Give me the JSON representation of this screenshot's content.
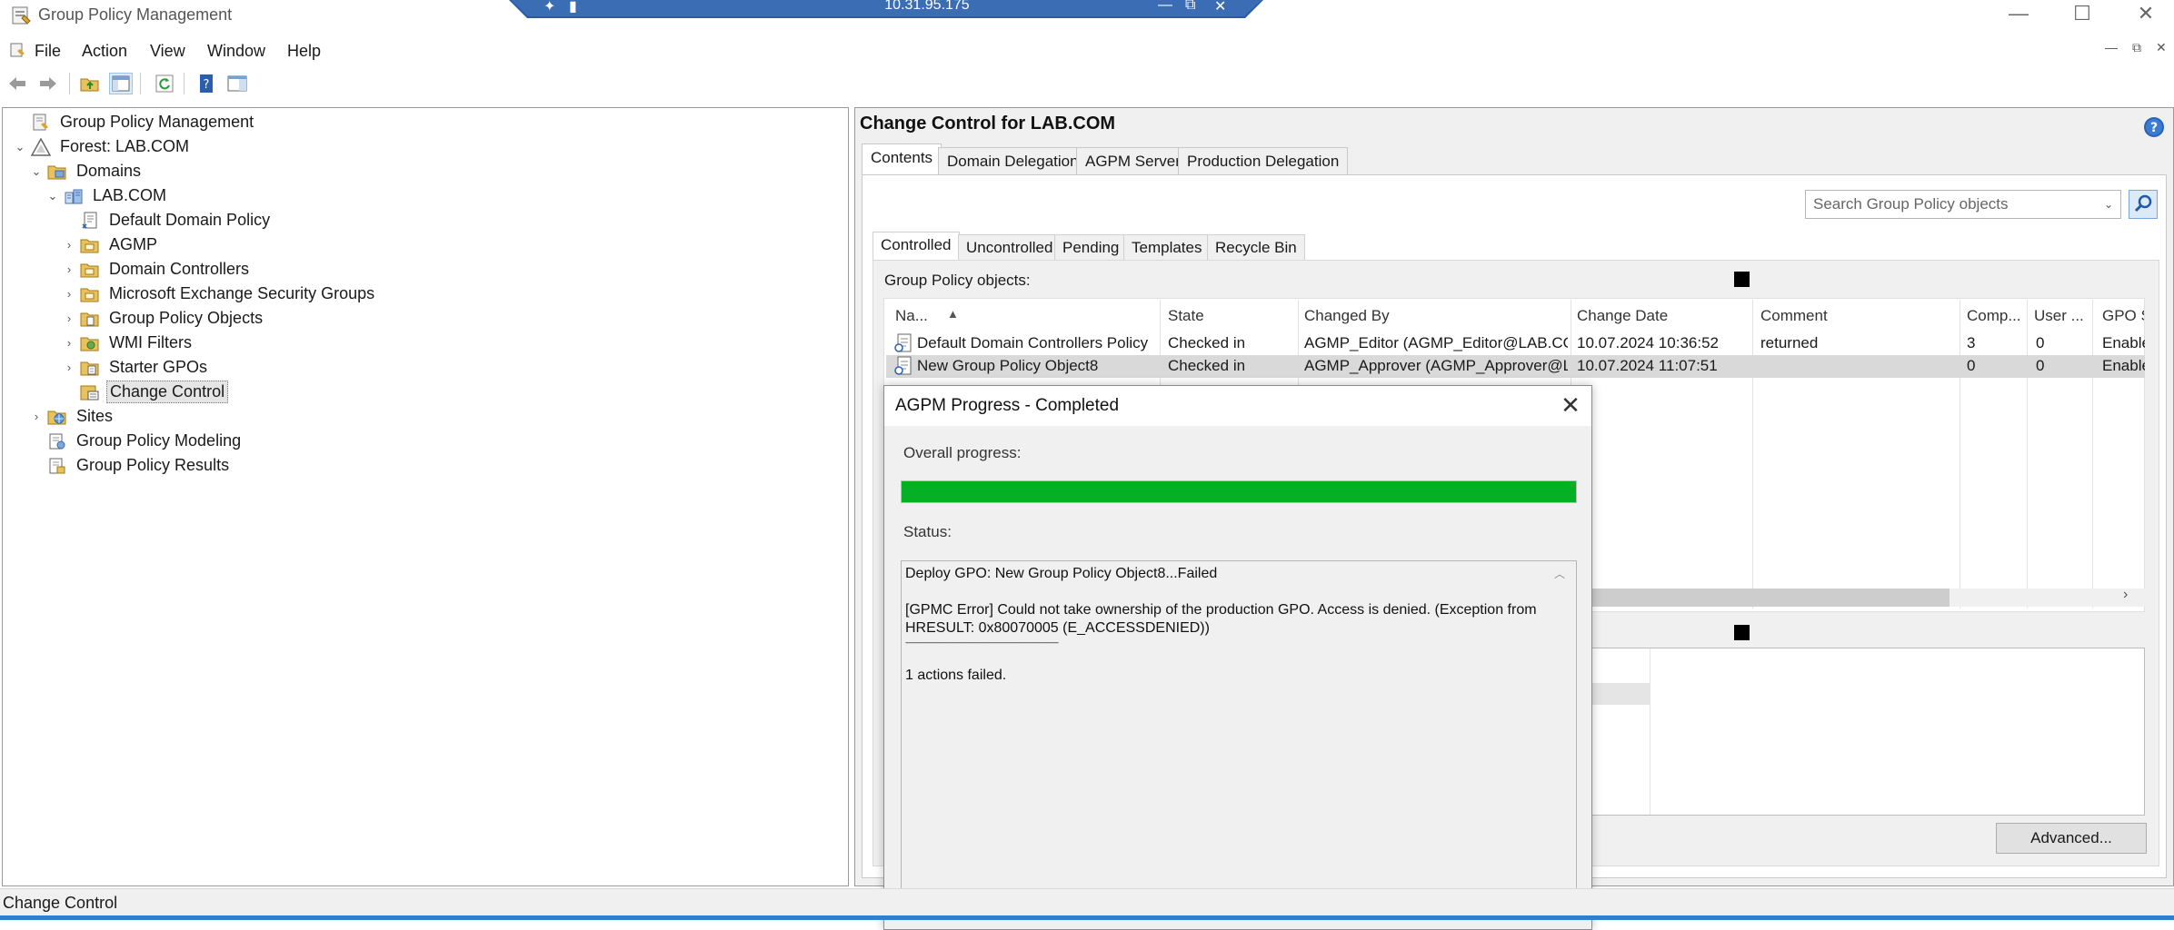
{
  "window": {
    "title": "Group Policy Management",
    "remote_host": "10.31.95.175",
    "controls": [
      "—",
      "☐",
      "✕"
    ]
  },
  "menu": [
    "File",
    "Action",
    "View",
    "Window",
    "Help"
  ],
  "tree": [
    {
      "label": "Group Policy Management",
      "icon": "gpm-console-icon",
      "expander": "",
      "depth": 0
    },
    {
      "label": "Forest: LAB.COM",
      "icon": "forest-icon",
      "expander": "⌄",
      "depth": 0
    },
    {
      "label": "Domains",
      "icon": "domains-folder-icon",
      "expander": "⌄",
      "depth": 1
    },
    {
      "label": "LAB.COM",
      "icon": "domain-icon",
      "expander": "⌄",
      "depth": 2
    },
    {
      "label": "Default Domain Policy",
      "icon": "gpo-link-icon",
      "expander": "",
      "depth": 3
    },
    {
      "label": "AGMP",
      "icon": "ou-folder-icon",
      "expander": "›",
      "depth": 3
    },
    {
      "label": "Domain Controllers",
      "icon": "ou-folder-icon",
      "expander": "›",
      "depth": 3
    },
    {
      "label": "Microsoft Exchange Security Groups",
      "icon": "ou-folder-icon",
      "expander": "›",
      "depth": 3
    },
    {
      "label": "Group Policy Objects",
      "icon": "gpo-folder-icon",
      "expander": "›",
      "depth": 3
    },
    {
      "label": "WMI Filters",
      "icon": "wmi-folder-icon",
      "expander": "›",
      "depth": 3
    },
    {
      "label": "Starter GPOs",
      "icon": "starter-folder-icon",
      "expander": "›",
      "depth": 3
    },
    {
      "label": "Change Control",
      "icon": "change-control-icon",
      "expander": "",
      "depth": 3,
      "selected": true
    },
    {
      "label": "Sites",
      "icon": "sites-icon",
      "expander": "›",
      "depth": 1
    },
    {
      "label": "Group Policy Modeling",
      "icon": "modeling-icon",
      "expander": "",
      "depth": 1
    },
    {
      "label": "Group Policy Results",
      "icon": "results-icon",
      "expander": "",
      "depth": 1
    }
  ],
  "change_control": {
    "title": "Change Control for LAB.COM",
    "tabs": [
      "Contents",
      "Domain Delegation",
      "AGPM Server",
      "Production Delegation"
    ],
    "active_tab": "Contents",
    "search_placeholder": "Search Group Policy objects",
    "subtabs": [
      "Controlled",
      "Uncontrolled",
      "Pending",
      "Templates",
      "Recycle Bin"
    ],
    "active_subtab": "Controlled",
    "gpo_label": "Group Policy objects:",
    "columns": [
      "Na...",
      "State",
      "Changed By",
      "Change Date",
      "Comment",
      "Comp...",
      "User ...",
      "GPO S"
    ],
    "rows": [
      [
        "Default Domain Controllers Policy",
        "Checked in",
        "AGMP_Editor (AGMP_Editor@LAB.COM)",
        "10.07.2024 10:36:52",
        "returned",
        "3",
        "0",
        "Enable"
      ],
      [
        "New Group Policy Object8",
        "Checked in",
        "AGMP_Approver (AGMP_Approver@L...",
        "10.07.2024 11:07:51",
        "",
        "0",
        "0",
        "Enable"
      ]
    ],
    "selected_row": 1,
    "advanced_button": "Advanced..."
  },
  "dialog": {
    "title": "AGPM Progress - Completed",
    "overall_label": "Overall progress:",
    "progress_percent": 100,
    "progress_color": "#06b025",
    "status_label": "Status:",
    "status_lines": [
      "Deploy GPO: New Group Policy Object8...Failed",
      "",
      "[GPMC Error] Could not take ownership of the production GPO. Access is denied. (Exception from HRESULT: 0x80070005 (E_ACCESSDENIED))",
      "-----------------------------------------------------------------------------------------------------",
      "",
      "1 actions failed."
    ]
  },
  "status_bar": "Change Control"
}
